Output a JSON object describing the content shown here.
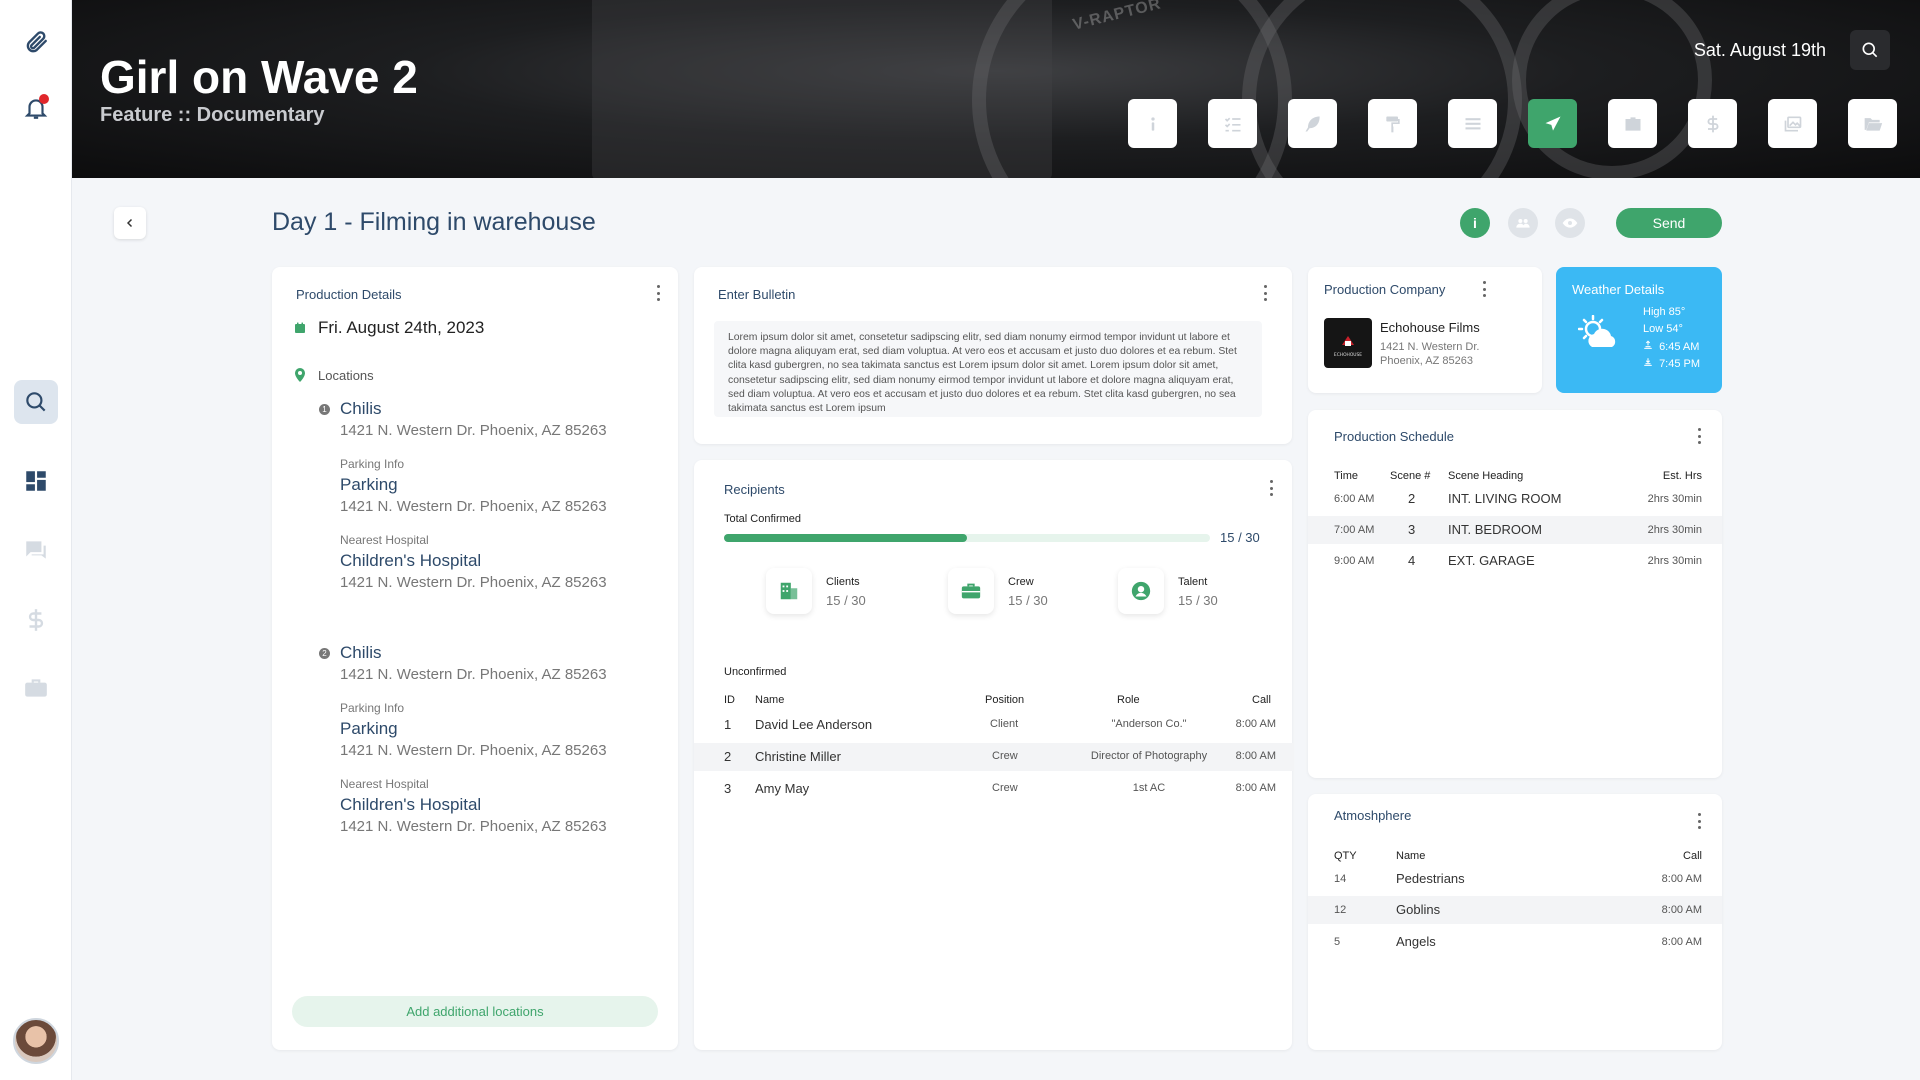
{
  "header": {
    "title": "Girl on Wave 2",
    "subtitle": "Feature :: Documentary",
    "date": "Sat. August 19th",
    "bg_text": "V-RAPTOR"
  },
  "sidebar": {
    "items": [
      {
        "icon": "paperclip-icon"
      },
      {
        "icon": "bell-icon",
        "has_notification": true
      },
      {
        "icon": "search-icon",
        "active": true
      },
      {
        "icon": "dashboard-icon"
      },
      {
        "icon": "chat-icon"
      },
      {
        "icon": "dollar-icon"
      },
      {
        "icon": "briefcase-icon"
      }
    ]
  },
  "toolbar": {
    "items": [
      {
        "icon": "info-icon"
      },
      {
        "icon": "checklist-icon"
      },
      {
        "icon": "feather-icon"
      },
      {
        "icon": "paint-roller-icon"
      },
      {
        "icon": "menu-lines-icon"
      },
      {
        "icon": "send-icon",
        "active": true
      },
      {
        "icon": "id-card-icon"
      },
      {
        "icon": "dollar-icon"
      },
      {
        "icon": "images-icon"
      },
      {
        "icon": "folder-open-icon"
      }
    ]
  },
  "page": {
    "title": "Day 1 - Filming in warehouse",
    "send_label": "Send",
    "info_glyph": "i"
  },
  "production_details": {
    "title": "Production Details",
    "date": "Fri. August 24th, 2023",
    "locations_label": "Locations",
    "locations": [
      {
        "num": "1",
        "name": "Chilis",
        "address": "1421 N. Western Dr. Phoenix, AZ 85263",
        "parking_label": "Parking Info",
        "parking_name": "Parking",
        "parking_address": "1421 N. Western Dr. Phoenix, AZ 85263",
        "hospital_label": "Nearest Hospital",
        "hospital_name": "Children's Hospital",
        "hospital_address": "1421 N. Western Dr. Phoenix, AZ 85263"
      },
      {
        "num": "2",
        "name": "Chilis",
        "address": "1421 N. Western Dr. Phoenix, AZ 85263",
        "parking_label": "Parking Info",
        "parking_name": "Parking",
        "parking_address": "1421 N. Western Dr. Phoenix, AZ 85263",
        "hospital_label": "Nearest Hospital",
        "hospital_name": "Children's Hospital",
        "hospital_address": "1421 N. Western Dr. Phoenix, AZ 85263"
      }
    ],
    "add_label": "Add additional locations"
  },
  "bulletin": {
    "title": "Enter Bulletin",
    "text": "Lorem ipsum dolor sit amet, consetetur sadipscing elitr, sed diam nonumy eirmod tempor invidunt ut labore et dolore magna aliquyam erat, sed diam voluptua. At vero eos et accusam et justo duo dolores et ea rebum. Stet clita kasd gubergren, no sea takimata sanctus est Lorem ipsum dolor sit amet. Lorem ipsum dolor sit amet, consetetur sadipscing elitr, sed diam nonumy eirmod tempor invidunt ut labore et dolore magna aliquyam erat, sed diam voluptua. At vero eos et accusam et justo duo dolores et ea rebum. Stet clita kasd gubergren, no sea takimata sanctus est Lorem ipsum"
  },
  "recipients": {
    "title": "Recipients",
    "total_label": "Total Confirmed",
    "total_value": "15 / 30",
    "progress": 0.5,
    "categories": [
      {
        "name": "Clients",
        "value": "15 / 30",
        "icon": "building-icon"
      },
      {
        "name": "Crew",
        "value": "15 / 30",
        "icon": "briefcase-icon"
      },
      {
        "name": "Talent",
        "value": "15 / 30",
        "icon": "user-circle-icon"
      }
    ],
    "unconfirmed_label": "Unconfirmed",
    "columns": [
      "ID",
      "Name",
      "Position",
      "Role",
      "Call"
    ],
    "rows": [
      {
        "id": "1",
        "name": "David Lee Anderson",
        "position": "Client",
        "role": "\"Anderson Co.\"",
        "call": "8:00 AM"
      },
      {
        "id": "2",
        "name": "Christine Miller",
        "position": "Crew",
        "role": "Director of Photography",
        "call": "8:00 AM"
      },
      {
        "id": "3",
        "name": "Amy May",
        "position": "Crew",
        "role": "1st AC",
        "call": "8:00 AM"
      }
    ]
  },
  "company": {
    "title": "Production Company",
    "name": "Echohouse Films",
    "address_line1": "1421 N. Western Dr.",
    "address_line2": "Phoenix, AZ 85263",
    "logo_text": "ECHOHOUSE"
  },
  "weather": {
    "title": "Weather Details",
    "high": "High 85°",
    "low": "Low 54°",
    "sunrise": "6:45 AM",
    "sunset": "7:45 PM",
    "icon": "partly-sunny-icon"
  },
  "schedule": {
    "title": "Production Schedule",
    "columns": [
      "Time",
      "Scene #",
      "Scene Heading",
      "Est. Hrs"
    ],
    "rows": [
      {
        "time": "6:00 AM",
        "scene": "2",
        "heading": "INT. LIVING ROOM",
        "est": "2hrs 30min"
      },
      {
        "time": "7:00 AM",
        "scene": "3",
        "heading": "INT. BEDROOM",
        "est": "2hrs 30min"
      },
      {
        "time": "9:00 AM",
        "scene": "4",
        "heading": "EXT. GARAGE",
        "est": "2hrs 30min"
      }
    ]
  },
  "atmosphere": {
    "title": "Atmoshphere",
    "columns": [
      "QTY",
      "Name",
      "Call"
    ],
    "rows": [
      {
        "qty": "14",
        "name": "Pedestrians",
        "call": "8:00 AM"
      },
      {
        "qty": "12",
        "name": "Goblins",
        "call": "8:00 AM"
      },
      {
        "qty": "5",
        "name": "Angels",
        "call": "8:00 AM"
      }
    ]
  },
  "colors": {
    "accent": "#3fa56c",
    "title_blue": "#2e4a6a",
    "weather_blue": "#3bb9f4",
    "notification_red": "#e0262b"
  }
}
